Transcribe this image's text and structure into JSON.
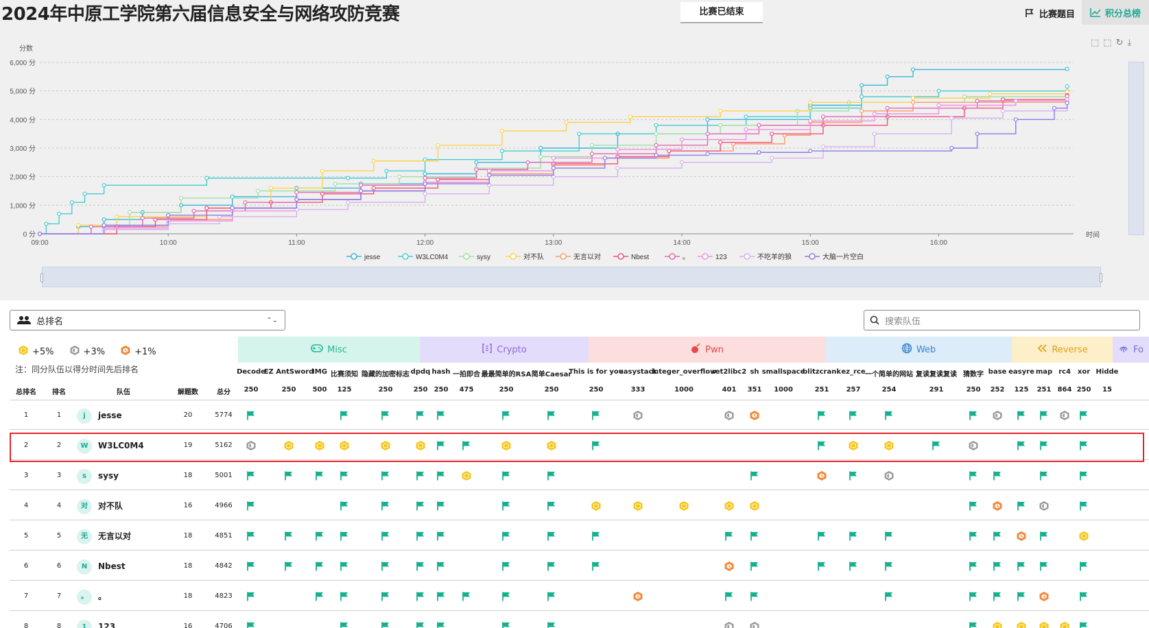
{
  "header": {
    "title": "2024年中原工学院第六届信息安全与网络攻防竞赛",
    "status": "比赛已结束",
    "problems_btn": "比赛题目",
    "scoreboard_btn": "积分总榜"
  },
  "chart_data": {
    "type": "line",
    "title": "",
    "ylabel": "分数",
    "xlabel": "时间",
    "y_ticks": [
      "0 分",
      "1,000 分",
      "2,000 分",
      "3,000 分",
      "4,000 分",
      "5,000 分",
      "6,000 分"
    ],
    "x_ticks": [
      "09:00",
      "10:00",
      "11:00",
      "12:00",
      "13:00",
      "14:00",
      "15:00",
      "16:00"
    ],
    "ylim": [
      0,
      6000
    ],
    "xlim_hours": [
      9,
      17.05
    ],
    "grid": true,
    "legend_position": "bottom",
    "series": [
      {
        "name": "jesse",
        "color": "#36b6dd",
        "points": [
          [
            9.0,
            0
          ],
          [
            9.3,
            250
          ],
          [
            9.5,
            500
          ],
          [
            9.8,
            750
          ],
          [
            10.1,
            1000
          ],
          [
            10.5,
            1300
          ],
          [
            11.0,
            1600
          ],
          [
            11.5,
            1750
          ],
          [
            12.0,
            2100
          ],
          [
            12.4,
            2500
          ],
          [
            12.9,
            3000
          ],
          [
            13.5,
            3500
          ],
          [
            14.2,
            4000
          ],
          [
            15.0,
            4500
          ],
          [
            15.4,
            5200
          ],
          [
            15.6,
            5500
          ],
          [
            15.8,
            5750
          ],
          [
            17.0,
            5774
          ]
        ]
      },
      {
        "name": "W3LC0M4",
        "color": "#47cccf",
        "points": [
          [
            9.0,
            0
          ],
          [
            9.05,
            350
          ],
          [
            9.15,
            700
          ],
          [
            9.25,
            1100
          ],
          [
            9.35,
            1400
          ],
          [
            9.5,
            1700
          ],
          [
            10.3,
            1950
          ],
          [
            11.4,
            1950
          ],
          [
            11.7,
            2200
          ],
          [
            12.0,
            2600
          ],
          [
            12.6,
            2900
          ],
          [
            13.2,
            3500
          ],
          [
            13.8,
            3800
          ],
          [
            14.5,
            4100
          ],
          [
            15.0,
            4400
          ],
          [
            15.4,
            4800
          ],
          [
            16.0,
            5000
          ],
          [
            17.0,
            5162
          ]
        ]
      },
      {
        "name": "sysy",
        "color": "#9fe0a7",
        "points": [
          [
            9.0,
            0
          ],
          [
            9.4,
            250
          ],
          [
            9.7,
            750
          ],
          [
            10.1,
            1250
          ],
          [
            10.7,
            1500
          ],
          [
            11.3,
            1750
          ],
          [
            11.8,
            2000
          ],
          [
            12.4,
            2300
          ],
          [
            12.9,
            2700
          ],
          [
            13.3,
            3100
          ],
          [
            13.8,
            3500
          ],
          [
            14.3,
            3800
          ],
          [
            14.9,
            4300
          ],
          [
            15.3,
            4600
          ],
          [
            16.2,
            4800
          ],
          [
            17.0,
            5001
          ]
        ]
      },
      {
        "name": "对不队",
        "color": "#ffd24d",
        "points": [
          [
            9.0,
            0
          ],
          [
            9.3,
            300
          ],
          [
            9.6,
            600
          ],
          [
            10.3,
            900
          ],
          [
            10.8,
            1600
          ],
          [
            11.2,
            2200
          ],
          [
            11.6,
            2550
          ],
          [
            12.1,
            3100
          ],
          [
            12.6,
            3600
          ],
          [
            13.1,
            3900
          ],
          [
            13.6,
            4100
          ],
          [
            14.3,
            4300
          ],
          [
            15.0,
            4600
          ],
          [
            15.8,
            4750
          ],
          [
            16.4,
            4900
          ],
          [
            17.0,
            4966
          ]
        ]
      },
      {
        "name": "无言以对",
        "color": "#ff9a6a",
        "points": [
          [
            9.0,
            0
          ],
          [
            9.6,
            250
          ],
          [
            10.0,
            500
          ],
          [
            10.5,
            900
          ],
          [
            11.0,
            1200
          ],
          [
            11.5,
            1500
          ],
          [
            12.0,
            1800
          ],
          [
            12.5,
            2100
          ],
          [
            13.0,
            2400
          ],
          [
            13.4,
            2650
          ],
          [
            13.9,
            2900
          ],
          [
            14.4,
            3150
          ],
          [
            14.8,
            3450
          ],
          [
            15.0,
            3900
          ],
          [
            15.4,
            4300
          ],
          [
            15.8,
            4600
          ],
          [
            17.0,
            4851
          ]
        ]
      },
      {
        "name": "Nbest",
        "color": "#f0527a",
        "points": [
          [
            9.0,
            0
          ],
          [
            9.6,
            250
          ],
          [
            9.9,
            500
          ],
          [
            10.3,
            900
          ],
          [
            10.8,
            1100
          ],
          [
            11.2,
            1400
          ],
          [
            11.6,
            1600
          ],
          [
            12.1,
            1900
          ],
          [
            12.5,
            2200
          ],
          [
            13.0,
            2450
          ],
          [
            13.5,
            2700
          ],
          [
            13.9,
            2900
          ],
          [
            14.3,
            3200
          ],
          [
            14.7,
            3500
          ],
          [
            15.1,
            3800
          ],
          [
            15.6,
            4100
          ],
          [
            16.2,
            4400
          ],
          [
            16.5,
            4700
          ],
          [
            17.0,
            4842
          ]
        ]
      },
      {
        "name": "。",
        "color": "#e266b3",
        "points": [
          [
            9.0,
            0
          ],
          [
            9.4,
            250
          ],
          [
            9.8,
            550
          ],
          [
            10.2,
            800
          ],
          [
            10.6,
            1100
          ],
          [
            11.0,
            1450
          ],
          [
            11.5,
            1700
          ],
          [
            12.0,
            1950
          ],
          [
            12.4,
            2250
          ],
          [
            12.8,
            2500
          ],
          [
            13.3,
            2800
          ],
          [
            13.8,
            3100
          ],
          [
            14.2,
            3500
          ],
          [
            14.6,
            3800
          ],
          [
            15.1,
            4100
          ],
          [
            15.6,
            4400
          ],
          [
            16.3,
            4650
          ],
          [
            17.0,
            4823
          ]
        ]
      },
      {
        "name": "123",
        "color": "#ee92e0",
        "points": [
          [
            9.0,
            0
          ],
          [
            9.5,
            200
          ],
          [
            10.0,
            450
          ],
          [
            10.5,
            800
          ],
          [
            11.0,
            1200
          ],
          [
            11.5,
            1500
          ],
          [
            12.0,
            1800
          ],
          [
            12.5,
            2200
          ],
          [
            13.0,
            2650
          ],
          [
            13.5,
            2950
          ],
          [
            14.0,
            3300
          ],
          [
            14.5,
            3650
          ],
          [
            15.0,
            3950
          ],
          [
            15.5,
            4200
          ],
          [
            16.0,
            4500
          ],
          [
            16.6,
            4650
          ],
          [
            17.0,
            4706
          ]
        ]
      },
      {
        "name": "不吃羊的狼",
        "color": "#d8b1ee",
        "points": [
          [
            9.0,
            0
          ],
          [
            9.5,
            150
          ],
          [
            10.0,
            350
          ],
          [
            10.4,
            600
          ],
          [
            11.0,
            850
          ],
          [
            11.4,
            1100
          ],
          [
            12.0,
            1400
          ],
          [
            12.5,
            1700
          ],
          [
            13.0,
            2000
          ],
          [
            13.5,
            2300
          ],
          [
            14.0,
            2500
          ],
          [
            14.7,
            2650
          ],
          [
            15.1,
            3050
          ],
          [
            15.5,
            3500
          ],
          [
            16.1,
            4050
          ],
          [
            16.5,
            4300
          ],
          [
            17.0,
            4600
          ]
        ]
      },
      {
        "name": "大脑一片空白",
        "color": "#8b7be8",
        "points": [
          [
            9.0,
            0
          ],
          [
            9.5,
            300
          ],
          [
            10.0,
            650
          ],
          [
            10.5,
            900
          ],
          [
            11.0,
            1200
          ],
          [
            11.5,
            1500
          ],
          [
            12.0,
            1750
          ],
          [
            12.5,
            2050
          ],
          [
            13.0,
            2300
          ],
          [
            13.4,
            2650
          ],
          [
            13.8,
            2750
          ],
          [
            14.2,
            2800
          ],
          [
            14.6,
            2850
          ],
          [
            15.0,
            2900
          ],
          [
            16.1,
            3000
          ],
          [
            16.3,
            3500
          ],
          [
            16.6,
            4000
          ],
          [
            16.9,
            4400
          ],
          [
            17.0,
            4580
          ]
        ]
      }
    ]
  },
  "filters": {
    "rank_select": "总排名",
    "search_placeholder": "搜索队伍"
  },
  "bonus": [
    {
      "label": "+5%",
      "color": "#f5c518"
    },
    {
      "label": "+3%",
      "color": "#9a9a9a"
    },
    {
      "label": "+1%",
      "color": "#f08a3c"
    }
  ],
  "note": "注：同分队伍以得分时间先后排名",
  "categories": [
    {
      "name": "Misc",
      "color": "#d5f5ec",
      "text": "#23b796",
      "icon": "gamepad-icon"
    },
    {
      "name": "Crypto",
      "color": "#e3dcfb",
      "text": "#8c6ad8",
      "icon": "brackets-icon"
    },
    {
      "name": "Pwn",
      "color": "#fcdede",
      "text": "#e84848",
      "icon": "bomb-icon"
    },
    {
      "name": "Web",
      "color": "#dcecf9",
      "text": "#3a84d0",
      "icon": "globe-icon"
    },
    {
      "name": "Reverse",
      "color": "#fcefc9",
      "text": "#e4a017",
      "icon": "rewind-icon"
    },
    {
      "name": "Fo",
      "color": "#e3dcfb",
      "text": "#6f6fd6",
      "icon": "fingerprint-icon"
    }
  ],
  "challenges": [
    {
      "name": "Decode",
      "score": "250"
    },
    {
      "name": "EZ AntSword",
      "score": "250"
    },
    {
      "name": "IMG",
      "score": "500"
    },
    {
      "name": "比赛须知",
      "score": "125"
    },
    {
      "name": "隐藏的加密标志",
      "score": "250"
    },
    {
      "name": "dpdq",
      "score": "250"
    },
    {
      "name": "hash",
      "score": "250"
    },
    {
      "name": "一拍即合",
      "score": "475"
    },
    {
      "name": "最最简单的RSA",
      "score": "250"
    },
    {
      "name": "简单Caesar",
      "score": "250"
    },
    {
      "name": "This is for you",
      "score": "250"
    },
    {
      "name": "easystack",
      "score": "333"
    },
    {
      "name": "integer_overflow",
      "score": "1000"
    },
    {
      "name": "ret2libc2",
      "score": "401"
    },
    {
      "name": "sh",
      "score": "351"
    },
    {
      "name": "smallspace",
      "score": "1000"
    },
    {
      "name": "blitzcrank",
      "score": "251"
    },
    {
      "name": "ez_rce",
      "score": "257"
    },
    {
      "name": "一个简单的网站",
      "score": "254"
    },
    {
      "name": "复读复读复读",
      "score": "291"
    },
    {
      "name": "猜数字",
      "score": "250"
    },
    {
      "name": "base",
      "score": "252"
    },
    {
      "name": "easyre",
      "score": "125"
    },
    {
      "name": "map",
      "score": "251"
    },
    {
      "name": "rc4",
      "score": "864"
    },
    {
      "name": "xor",
      "score": "250"
    },
    {
      "name": "Hidde",
      "score": "15"
    }
  ],
  "table_headers": {
    "overall": "总排名",
    "rank": "排名",
    "team": "队伍",
    "solved": "解题数",
    "total": "总分"
  },
  "teams": [
    {
      "overall": "1",
      "rank": "1",
      "avatar": "j",
      "name": "jesse",
      "solved": "20",
      "total": "5774",
      "marks": [
        "f",
        "",
        "",
        "f",
        "f",
        "f",
        "f",
        "",
        "f",
        "f",
        "f",
        "s",
        "",
        "s",
        "b",
        "",
        "f",
        "f",
        "f",
        "",
        "f",
        "s",
        "f",
        "f",
        "s",
        "f",
        ""
      ]
    },
    {
      "overall": "2",
      "rank": "2",
      "avatar": "W",
      "name": "W3LC0M4",
      "solved": "19",
      "total": "5162",
      "marks": [
        "s",
        "g",
        "g",
        "g",
        "g",
        "g",
        "f",
        "f",
        "g",
        "g",
        "f",
        "",
        "",
        "",
        "",
        "",
        "f",
        "g",
        "g",
        "f",
        "s",
        "",
        "f",
        "f",
        "",
        "f",
        ""
      ]
    },
    {
      "overall": "3",
      "rank": "3",
      "avatar": "s",
      "name": "sysy",
      "solved": "18",
      "total": "5001",
      "marks": [
        "f",
        "f",
        "f",
        "f",
        "f",
        "f",
        "f",
        "g",
        "f",
        "f",
        "",
        "",
        "",
        "",
        "f",
        "",
        "b",
        "f",
        "s",
        "",
        "f",
        "f",
        "",
        "f",
        "",
        "f",
        ""
      ]
    },
    {
      "overall": "4",
      "rank": "4",
      "avatar": "对",
      "name": "对不队",
      "solved": "16",
      "total": "4966",
      "marks": [
        "f",
        "",
        "",
        "f",
        "f",
        "f",
        "f",
        "",
        "f",
        "f",
        "g",
        "g",
        "g",
        "g",
        "g",
        "",
        "",
        "",
        "",
        "",
        "f",
        "b",
        "f",
        "s",
        "",
        "f",
        ""
      ]
    },
    {
      "overall": "5",
      "rank": "5",
      "avatar": "无",
      "name": "无言以对",
      "solved": "18",
      "total": "4851",
      "marks": [
        "f",
        "f",
        "f",
        "f",
        "f",
        "f",
        "f",
        "",
        "f",
        "f",
        "f",
        "",
        "",
        "f",
        "f",
        "",
        "f",
        "f",
        "f",
        "",
        "f",
        "f",
        "b",
        "f",
        "",
        "g",
        ""
      ]
    },
    {
      "overall": "6",
      "rank": "6",
      "avatar": "N",
      "name": "Nbest",
      "solved": "18",
      "total": "4842",
      "marks": [
        "f",
        "f",
        "f",
        "f",
        "f",
        "f",
        "f",
        "",
        "f",
        "f",
        "f",
        "",
        "",
        "b",
        "f",
        "",
        "f",
        "f",
        "f",
        "",
        "f",
        "f",
        "f",
        "f",
        "",
        "f",
        ""
      ]
    },
    {
      "overall": "7",
      "rank": "7",
      "avatar": "。",
      "name": "。",
      "solved": "18",
      "total": "4823",
      "marks": [
        "f",
        "",
        "f",
        "f",
        "f",
        "f",
        "f",
        "f",
        "f",
        "f",
        "",
        "b",
        "",
        "f",
        "f",
        "",
        "",
        "",
        "f",
        "",
        "f",
        "f",
        "f",
        "b",
        "",
        "f",
        ""
      ]
    },
    {
      "overall": "8",
      "rank": "8",
      "avatar": "1",
      "name": "123",
      "solved": "16",
      "total": "4706",
      "marks": [
        "f",
        "",
        "",
        "f",
        "f",
        "f",
        "f",
        "",
        "f",
        "f",
        "",
        "",
        "",
        "s",
        "s",
        "",
        "",
        "",
        "",
        "",
        "f",
        "g",
        "g",
        "g",
        "g",
        "f",
        ""
      ]
    }
  ]
}
